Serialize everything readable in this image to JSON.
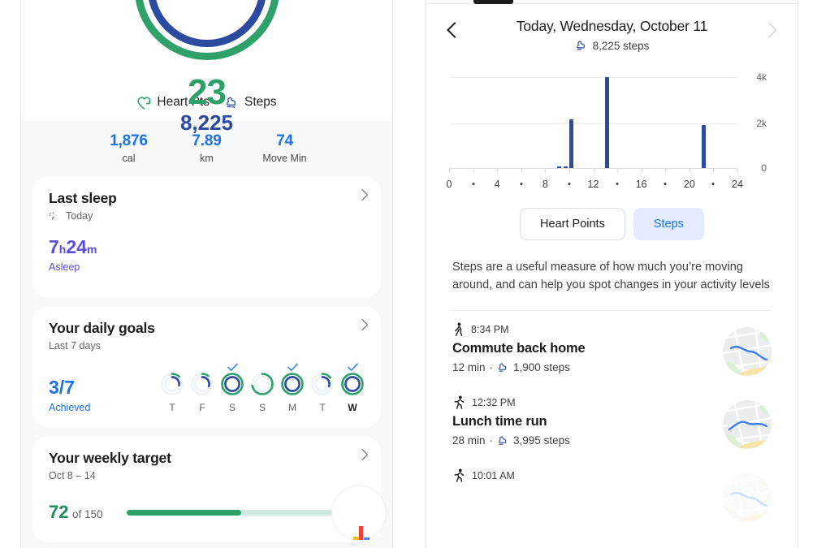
{
  "left": {
    "rings": {
      "heart_points": "23",
      "steps": "8,225",
      "heart_color": "#2ea06a",
      "steps_color": "#2a4ba0"
    },
    "legend": [
      {
        "label": "Heart Pts",
        "icon": "heart-arrow-icon"
      },
      {
        "label": "Steps",
        "icon": "shoe-icon"
      }
    ],
    "stats": [
      {
        "value": "1,876",
        "label": "cal"
      },
      {
        "value": "7.89",
        "label": "km"
      },
      {
        "value": "74",
        "label": "Move Min"
      }
    ],
    "cards": [
      {
        "id": "last-sleep",
        "title": "Last sleep",
        "subtitle": "Today",
        "subtitle_icon": "sleep-zzz-icon",
        "value_num": "7",
        "value_unit1": "h",
        "value_num2": "24",
        "value_unit2": "m",
        "value_sub": "Asleep"
      },
      {
        "id": "daily-goals",
        "title": "Your daily goals",
        "subtitle": "Last 7 days",
        "fraction": "3/7",
        "fraction_sub": "Achieved",
        "days": [
          {
            "label": "T",
            "achieved": false,
            "heart_pct": 12,
            "steps_pct": 28,
            "current": false
          },
          {
            "label": "F",
            "achieved": false,
            "heart_pct": 10,
            "steps_pct": 30,
            "current": false
          },
          {
            "label": "S",
            "achieved": true,
            "heart_pct": 100,
            "steps_pct": 100,
            "current": false
          },
          {
            "label": "S",
            "achieved": false,
            "heart_pct": 72,
            "steps_pct": 0,
            "current": false
          },
          {
            "label": "M",
            "achieved": true,
            "heart_pct": 100,
            "steps_pct": 100,
            "current": false
          },
          {
            "label": "T",
            "achieved": false,
            "heart_pct": 14,
            "steps_pct": 30,
            "current": false
          },
          {
            "label": "W",
            "achieved": true,
            "heart_pct": 100,
            "steps_pct": 100,
            "current": true
          }
        ]
      },
      {
        "id": "weekly-target",
        "title": "Your weekly target",
        "subtitle": "Oct 8 – 14",
        "value": "72",
        "value_of": "of 150",
        "progress_pct": 48
      }
    ]
  },
  "right": {
    "header": {
      "title": "Today, Wednesday, October 11",
      "steps_summary": "8,225 steps",
      "steps_icon": "shoe-icon",
      "prev_icon": "chevron-left-icon",
      "next_icon": "chevron-right-icon"
    },
    "segments": [
      {
        "label": "Heart Points",
        "active": false
      },
      {
        "label": "Steps",
        "active": true
      }
    ],
    "description": "Steps are a useful measure of how much you’re moving around, and can help you spot changes in your activity levels",
    "activities": [
      {
        "time": "8:34 PM",
        "icon": "walking-icon",
        "name": "Commute back home",
        "duration": "12 min",
        "separator": "·",
        "steps": "1,900 steps",
        "steps_icon": "shoe-icon"
      },
      {
        "time": "12:32 PM",
        "icon": "running-icon",
        "name": "Lunch time run",
        "duration": "28 min",
        "separator": "·",
        "steps": "3,995 steps",
        "steps_icon": "shoe-icon"
      },
      {
        "time": "10:01 AM",
        "icon": "running-icon",
        "name": "",
        "duration": "",
        "separator": "",
        "steps": "",
        "steps_icon": "shoe-icon"
      }
    ]
  },
  "chart_data": {
    "type": "bar",
    "title": "Today, Wednesday, October 11",
    "subtitle": "8,225 steps",
    "xlabel": "",
    "ylabel": "",
    "xlim": [
      0,
      24
    ],
    "ylim": [
      0,
      4400
    ],
    "ytick_values": [
      0,
      2000,
      4000
    ],
    "ytick_labels": [
      "0",
      "2k",
      "4k"
    ],
    "xtick_values": [
      0,
      2,
      4,
      6,
      8,
      10,
      12,
      14,
      16,
      18,
      20,
      22,
      24
    ],
    "xtick_labels": [
      "0",
      "·",
      "4",
      "·",
      "8",
      "·",
      "12",
      "·",
      "16",
      "·",
      "20",
      "·",
      "24"
    ],
    "grid": true,
    "bar_color": "#2a4ba0",
    "x": [
      9.0,
      9.5,
      10.0,
      13.0,
      21.0
    ],
    "values": [
      120,
      110,
      2150,
      4000,
      1900
    ],
    "categories": [
      "9:00",
      "9:30",
      "10:00",
      "13:00",
      "21:00"
    ],
    "legend_position": "none"
  }
}
